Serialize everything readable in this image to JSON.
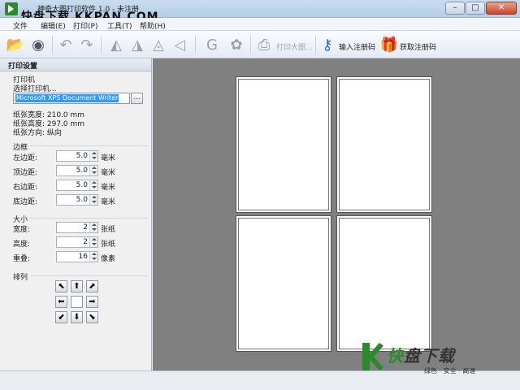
{
  "window": {
    "title": "神奇大图打印软件 1.0 - 未注册",
    "watermark": "快盘下载 KKPAN.COM"
  },
  "menu": [
    "文件",
    "编辑(E)",
    "打印(P)",
    "工具(T)",
    "帮助(H)"
  ],
  "toolbar": {
    "print_big": "打印大图...",
    "enter_code": "输入注册码",
    "get_code": "获取注册码"
  },
  "panel": {
    "header": "打印设置",
    "printer_group": "打印机",
    "select_printer": "选择打印机...",
    "printer_value": "Microsoft XPS Document Writer",
    "ellipsis": "...",
    "paper_width": "纸张宽度: 210.0 mm",
    "paper_height": "纸张高度: 297.0 mm",
    "paper_orient": "纸张方向: 纵向",
    "margin_group": "边框",
    "margins": [
      {
        "label": "左边距:",
        "value": "5.0",
        "unit": "毫米"
      },
      {
        "label": "顶边距:",
        "value": "5.0",
        "unit": "毫米"
      },
      {
        "label": "右边距:",
        "value": "5.0",
        "unit": "毫米"
      },
      {
        "label": "底边距:",
        "value": "5.0",
        "unit": "毫米"
      }
    ],
    "size_group": "大小",
    "sizes": [
      {
        "label": "宽度:",
        "value": "2",
        "unit": "张纸"
      },
      {
        "label": "高度:",
        "value": "2",
        "unit": "张纸"
      },
      {
        "label": "重叠:",
        "value": "16",
        "unit": "像素"
      }
    ],
    "arrange_group": "排列"
  },
  "brand": {
    "main_green": "快",
    "main_dark": "盘下载",
    "sub": "绿色 · 安全 · 高速"
  }
}
